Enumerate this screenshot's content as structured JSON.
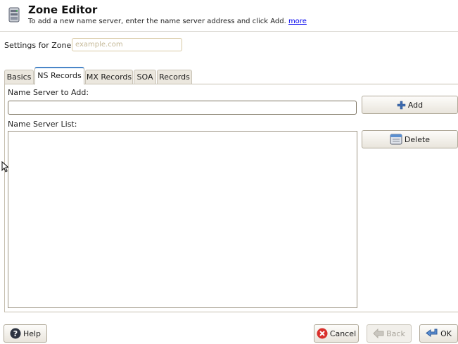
{
  "header": {
    "title": "Zone Editor",
    "subtitle": "To add a new name server, enter the name server address and click Add.",
    "more_link": "more"
  },
  "zone": {
    "label": "Settings for Zone",
    "placeholder": "example.com",
    "value": ""
  },
  "tabs": [
    {
      "label": "Basics",
      "active": false
    },
    {
      "label": "NS Records",
      "active": true
    },
    {
      "label": "MX Records",
      "active": false
    },
    {
      "label": "SOA",
      "active": false
    },
    {
      "label": "Records",
      "active": false
    }
  ],
  "ns": {
    "add_label": "Name Server to Add:",
    "add_value": "",
    "list_label": "Name Server List:",
    "items": [],
    "add_button": "Add",
    "delete_button": "Delete"
  },
  "footer": {
    "help": "Help",
    "cancel": "Cancel",
    "back": "Back",
    "ok": "OK"
  },
  "colors": {
    "accent_tab": "#4a86c8",
    "cancel_icon": "#d9302c",
    "link": "#0000ee"
  }
}
